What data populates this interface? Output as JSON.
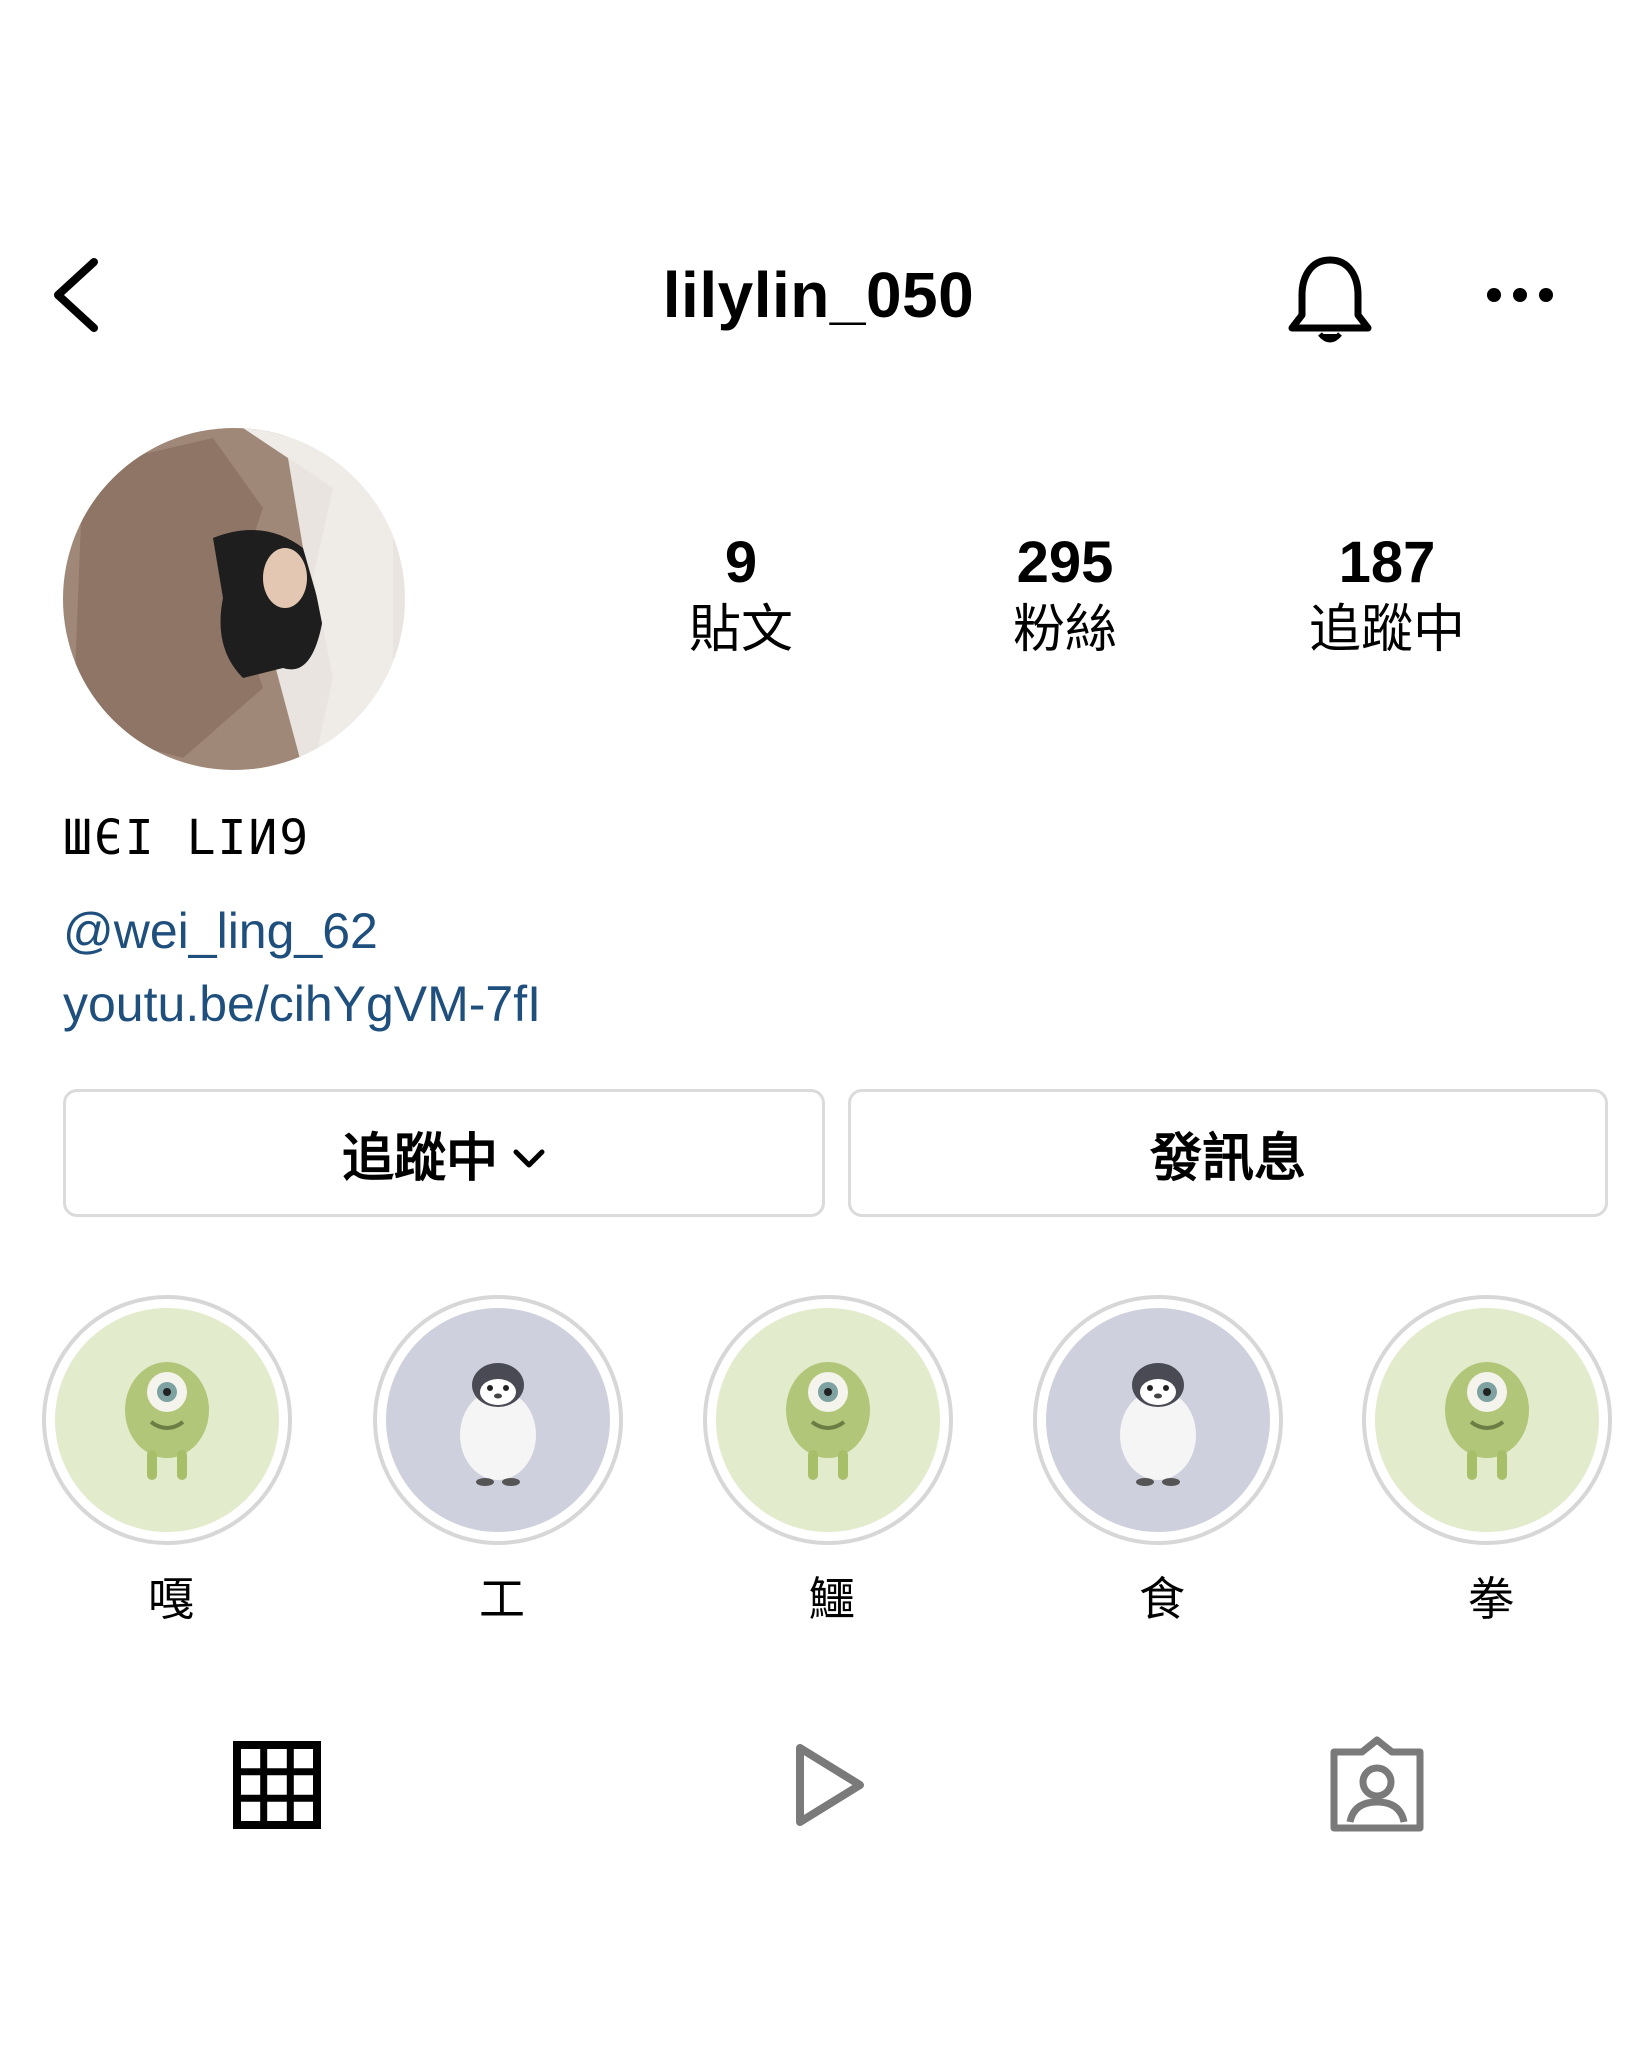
{
  "header": {
    "username": "lilylin_050",
    "back_icon": "chevron-left-icon",
    "bell_icon": "bell-icon",
    "more_icon": "ellipsis-icon"
  },
  "stats": [
    {
      "count": "9",
      "label": "貼文"
    },
    {
      "count": "295",
      "label": "粉絲"
    },
    {
      "count": "187",
      "label": "追蹤中"
    }
  ],
  "profile": {
    "display_name": "ШЄI LIИ9",
    "mention": "@wei_ling_62",
    "link": "youtu.be/cihYgVM-7fI"
  },
  "actions": {
    "following_label": "追蹤中",
    "message_label": "發訊息"
  },
  "highlights": [
    {
      "label": "嘎",
      "theme": "green"
    },
    {
      "label": "工",
      "theme": "lavender"
    },
    {
      "label": "鱷",
      "theme": "green"
    },
    {
      "label": "食",
      "theme": "lavender"
    },
    {
      "label": "拳",
      "theme": "green"
    }
  ],
  "tabs": {
    "grid_icon": "grid-icon",
    "reels_icon": "play-icon",
    "tagged_icon": "tagged-person-icon"
  },
  "colors": {
    "link": "#1f4f7d",
    "highlight_green": "#e3ebcd",
    "highlight_lavender": "#cfd0dd",
    "border": "#dbdbdb"
  }
}
